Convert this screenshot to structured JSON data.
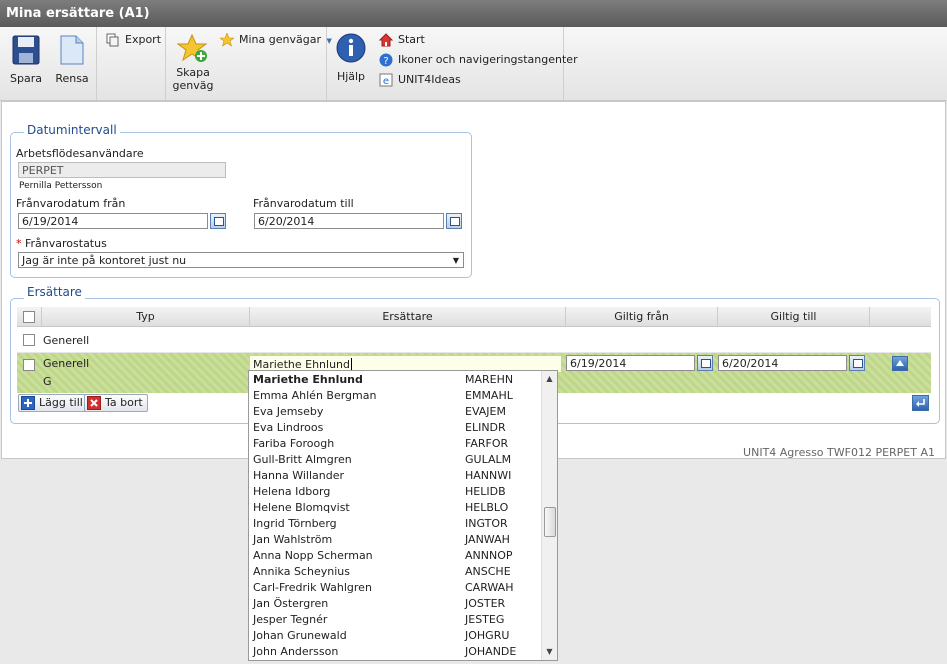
{
  "window": {
    "title": "Mina ersättare (A1)"
  },
  "toolbar": {
    "save": "Spara",
    "clear": "Rensa",
    "export": "Export",
    "create_shortcut": "Skapa genväg",
    "my_shortcuts": "Mina genvägar",
    "help": "Hjälp",
    "start": "Start",
    "icons_nav": "Ikoner och navigeringstangenter",
    "ideas": "UNIT4Ideas"
  },
  "date_interval": {
    "legend": "Datumintervall",
    "workflow_user_label": "Arbetsflödesanvändare",
    "workflow_user_value": "PERPET",
    "workflow_user_name": "Pernilla Pettersson",
    "from_label": "Frånvarodatum från",
    "from_value": "6/19/2014",
    "to_label": "Frånvarodatum till",
    "to_value": "6/20/2014",
    "status_required": "*",
    "status_label": "Frånvarostatus",
    "status_value": "Jag är inte på kontoret just nu"
  },
  "substitutes": {
    "legend": "Ersättare",
    "columns": [
      "Typ",
      "Ersättare",
      "Giltig från",
      "Giltig till"
    ],
    "rows": [
      {
        "type": "Generell"
      },
      {
        "type": "Generell",
        "type_sub": "G",
        "substitute": "Mariethe Ehnlund",
        "from": "6/19/2014",
        "to": "6/20/2014"
      }
    ],
    "add": "Lägg till",
    "remove": "Ta bort"
  },
  "dropdown": {
    "items": [
      {
        "name": "Mariethe Ehnlund",
        "code": "MAREHN"
      },
      {
        "name": "Emma Ahlén Bergman",
        "code": "EMMAHL"
      },
      {
        "name": "Eva Jemseby",
        "code": "EVAJEM"
      },
      {
        "name": "Eva Lindroos",
        "code": "ELINDR"
      },
      {
        "name": "Fariba Foroogh",
        "code": "FARFOR"
      },
      {
        "name": "Gull-Britt Almgren",
        "code": "GULALM"
      },
      {
        "name": "Hanna Willander",
        "code": "HANNWI"
      },
      {
        "name": "Helena Idborg",
        "code": "HELIDB"
      },
      {
        "name": "Helene Blomqvist",
        "code": "HELBLO"
      },
      {
        "name": "Ingrid Törnberg",
        "code": "INGTOR"
      },
      {
        "name": "Jan Wahlström",
        "code": "JANWAH"
      },
      {
        "name": "Anna Nopp Scherman",
        "code": "ANNNOP"
      },
      {
        "name": "Annika Scheynius",
        "code": "ANSCHE"
      },
      {
        "name": "Carl-Fredrik Wahlgren",
        "code": "CARWAH"
      },
      {
        "name": "Jan Östergren",
        "code": "JOSTER"
      },
      {
        "name": "Jesper Tegnér",
        "code": "JESTEG"
      },
      {
        "name": "Johan Grunewald",
        "code": "JOHGRU"
      },
      {
        "name": "John Andersson",
        "code": "JOHANDE"
      }
    ]
  },
  "footer": {
    "text": "UNIT4 Agresso  TWF012  PERPET  A1"
  },
  "colors": {
    "accent": "#1d4d8a",
    "selected_row": "#c9df9a",
    "title_bar": "#6b6b6b"
  }
}
